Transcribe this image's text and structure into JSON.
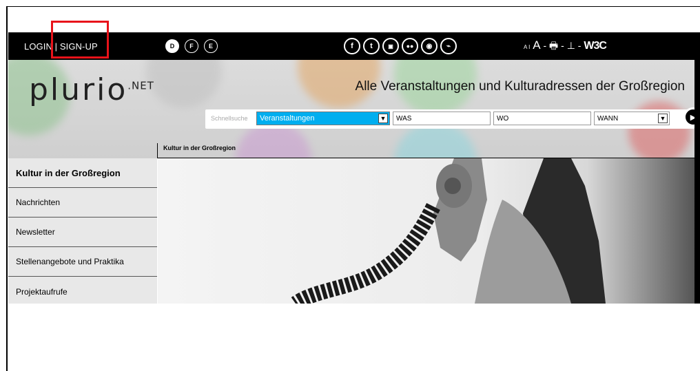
{
  "topbar": {
    "login_label": "LOGIN | SIGN-UP",
    "languages": [
      "D",
      "F",
      "E"
    ],
    "active_language": "D",
    "social": [
      "f",
      "t",
      "yt",
      "oo",
      "ap",
      "rss"
    ],
    "tools": {
      "small_a": "A I",
      "big_a": "A",
      "sep": "-"
    },
    "w3c": "W3C"
  },
  "header": {
    "logo": "plurio",
    "logo_suffix": ".NET",
    "tagline": "Alle Veranstaltungen und Kulturadressen der Großregion"
  },
  "search": {
    "label": "Schnellsuche",
    "type_value": "Veranstaltungen",
    "was_value": "WAS",
    "wo_value": "WO",
    "wann_value": "WANN"
  },
  "breadcrumb": "Kultur in der Großregion",
  "sidebar": {
    "items": [
      {
        "label": "Kultur in der Großregion",
        "active": true
      },
      {
        "label": "Nachrichten",
        "active": false
      },
      {
        "label": "Newsletter",
        "active": false
      },
      {
        "label": "Stellenangebote und Praktika",
        "active": false
      },
      {
        "label": "Projektaufrufe",
        "active": false
      }
    ]
  },
  "colors": {
    "accent": "#00aeef",
    "highlight": "#e8131a",
    "bar": "#000000"
  }
}
